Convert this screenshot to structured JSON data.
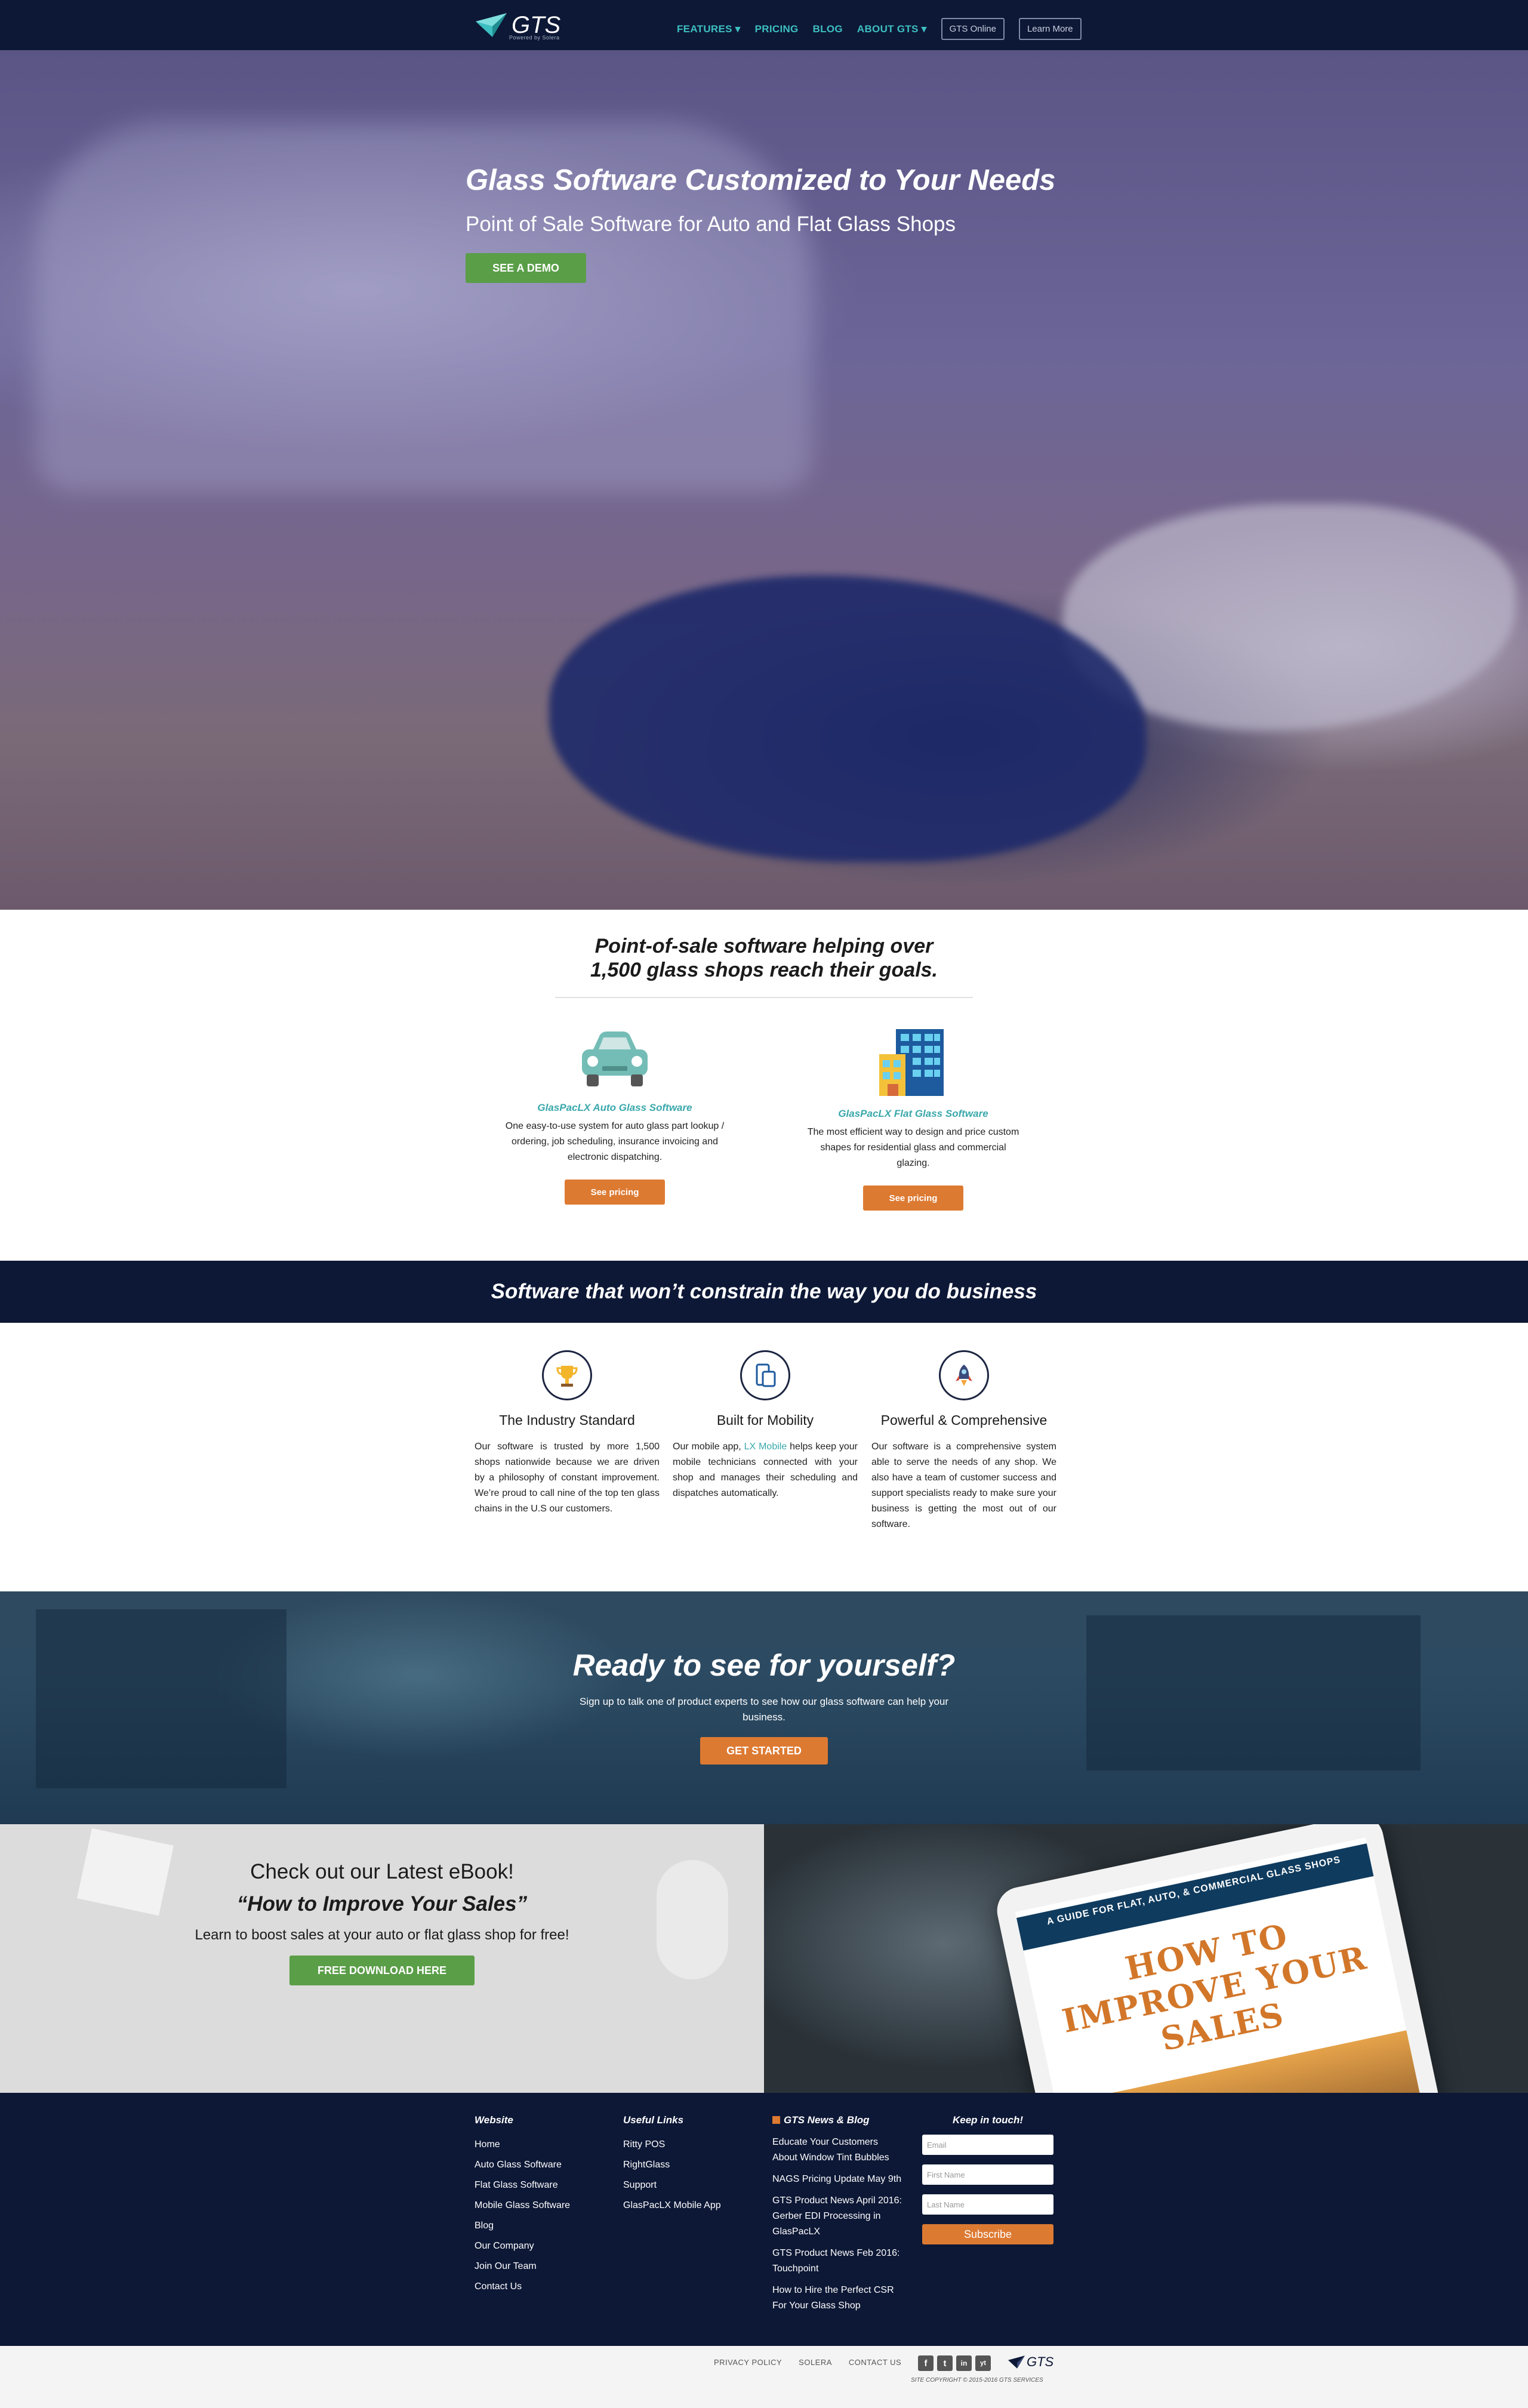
{
  "nav": {
    "logo_text": "GTS",
    "logo_sub": "Powered by Solera",
    "links": [
      "FEATURES",
      "PRICING",
      "BLOG",
      "ABOUT GTS"
    ],
    "btn_online": "GTS Online",
    "btn_learn": "Learn More"
  },
  "hero": {
    "title": "Glass Software Customized to Your Needs",
    "subtitle": "Point of Sale Software for Auto and Flat Glass Shops",
    "demo_label": "SEE A DEMO"
  },
  "intro": {
    "title_line1": "Point-of-sale software helping over",
    "title_line2": "1,500 glass shops reach their goals.",
    "products": [
      {
        "name": "GlasPacLX Auto Glass Software",
        "desc": "One easy-to-use system for auto glass part lookup / ordering, job scheduling, insurance invoicing and electronic dispatching.",
        "button": "See pricing"
      },
      {
        "name": "GlasPacLX Flat Glass Software",
        "desc": "The most efficient way to design and price custom shapes for residential glass and commercial glazing.",
        "button": "See pricing"
      }
    ]
  },
  "band": {
    "text": "Software that won’t constrain the way you do business"
  },
  "features": [
    {
      "title": "The Industry Standard",
      "text": "Our software is trusted by more 1,500 shops nationwide because we are driven by a philosophy of constant improvement. We’re proud to call nine of the top ten glass chains in the U.S our customers."
    },
    {
      "title": "Built for Mobility",
      "text_pre": "Our mobile app, ",
      "link": "LX Mobile",
      "text_post": " helps keep your mobile technicians connected with your shop and manages their scheduling and dispatches automatically."
    },
    {
      "title": "Powerful & Comprehensive",
      "text": "Our software is a comprehensive system able to serve the needs of any shop. We also have a team of customer success and support specialists ready to make sure your business is getting the most out of our software."
    }
  ],
  "ready": {
    "title": "Ready to see for yourself?",
    "text": "Sign up to talk one of product experts to see how our glass software can help your business.",
    "button": "GET STARTED"
  },
  "ebook": {
    "line1": "Check out our Latest eBook!",
    "line2": "“How to Improve Your Sales”",
    "line3": "Learn to boost sales at your auto or flat glass shop for free!",
    "button": "FREE DOWNLOAD HERE",
    "cover_band": "A GUIDE FOR FLAT, AUTO, & COMMERCIAL GLASS SHOPS",
    "cover_title": "HOW TO IMPROVE YOUR SALES"
  },
  "footer": {
    "website": {
      "heading": "Website",
      "links": [
        "Home",
        "Auto Glass Software",
        "Flat Glass Software",
        "Mobile Glass Software",
        "Blog",
        "Our Company",
        "Join Our Team",
        "Contact Us"
      ]
    },
    "useful": {
      "heading": "Useful Links",
      "links": [
        "Ritty POS",
        "RightGlass",
        "Support",
        "GlasPacLX Mobile App"
      ]
    },
    "news": {
      "heading": "GTS News & Blog",
      "links": [
        "Educate Your Customers About Window Tint Bubbles",
        "NAGS Pricing Update May 9th",
        "GTS Product News April 2016: Gerber EDI Processing in GlasPacLX",
        "GTS Product News Feb 2016: Touchpoint",
        "How to Hire the Perfect CSR For Your Glass Shop"
      ]
    },
    "touch": {
      "heading": "Keep in touch!",
      "email_ph": "Email",
      "first_ph": "First Name",
      "last_ph": "Last Name",
      "subscribe": "Subscribe"
    }
  },
  "bottom": {
    "links": [
      "PRIVACY POLICY",
      "SOLERA",
      "CONTACT US"
    ],
    "social": [
      "f",
      "t",
      "in",
      "yt"
    ],
    "logo_text": "GTS",
    "copyright": "SITE COPYRIGHT © 2015-2016 GTS SERVICES"
  },
  "colors": {
    "navy": "#0d1836",
    "teal": "#3dbfc1",
    "green": "#5a9e48",
    "orange": "#dd7a32"
  }
}
